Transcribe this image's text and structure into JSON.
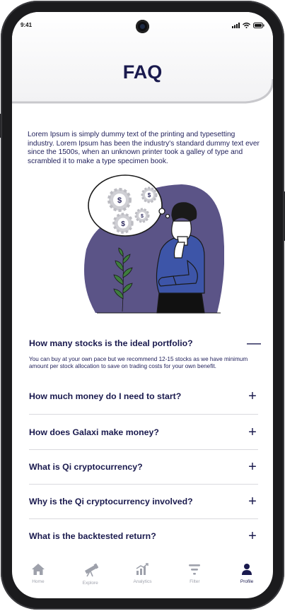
{
  "status": {
    "time": "9:41"
  },
  "header": {
    "title": "FAQ"
  },
  "intro": "Lorem Ipsum is simply dummy text of the printing and typesetting industry. Lorem Ipsum has been the industry's standard dummy text ever since the 1500s, when an unknown printer took a galley of type and scrambled it to make a type specimen book.",
  "faq": [
    {
      "question": "How many stocks is the ideal portfolio?",
      "expanded": true,
      "toggle": "—",
      "answer": "You can buy at your own pace but we recommend 12-15 stocks as we have minimum amount per stock allocation to save on trading costs for your own benefit."
    },
    {
      "question": "How much money do I need to start?",
      "expanded": false,
      "toggle": "+"
    },
    {
      "question": "How does Galaxi make money?",
      "expanded": false,
      "toggle": "+"
    },
    {
      "question": "What is Qi cryptocurrency?",
      "expanded": false,
      "toggle": "+"
    },
    {
      "question": "Why is the Qi cryptocurrency involved?",
      "expanded": false,
      "toggle": "+"
    },
    {
      "question": "What is the backtested return?",
      "expanded": false,
      "toggle": "+"
    }
  ],
  "nav": [
    {
      "label": "Home",
      "icon": "home-icon"
    },
    {
      "label": "Explore",
      "icon": "telescope-icon"
    },
    {
      "label": "Analytics",
      "icon": "bar-chart-icon"
    },
    {
      "label": "Filter",
      "icon": "filter-icon"
    },
    {
      "label": "Profile",
      "icon": "profile-icon",
      "active": true
    }
  ],
  "colors": {
    "primary": "#1a1a4e",
    "accent_purple": "#5b5487",
    "shirt_blue": "#3d55a8",
    "muted": "#a0a3ad"
  }
}
